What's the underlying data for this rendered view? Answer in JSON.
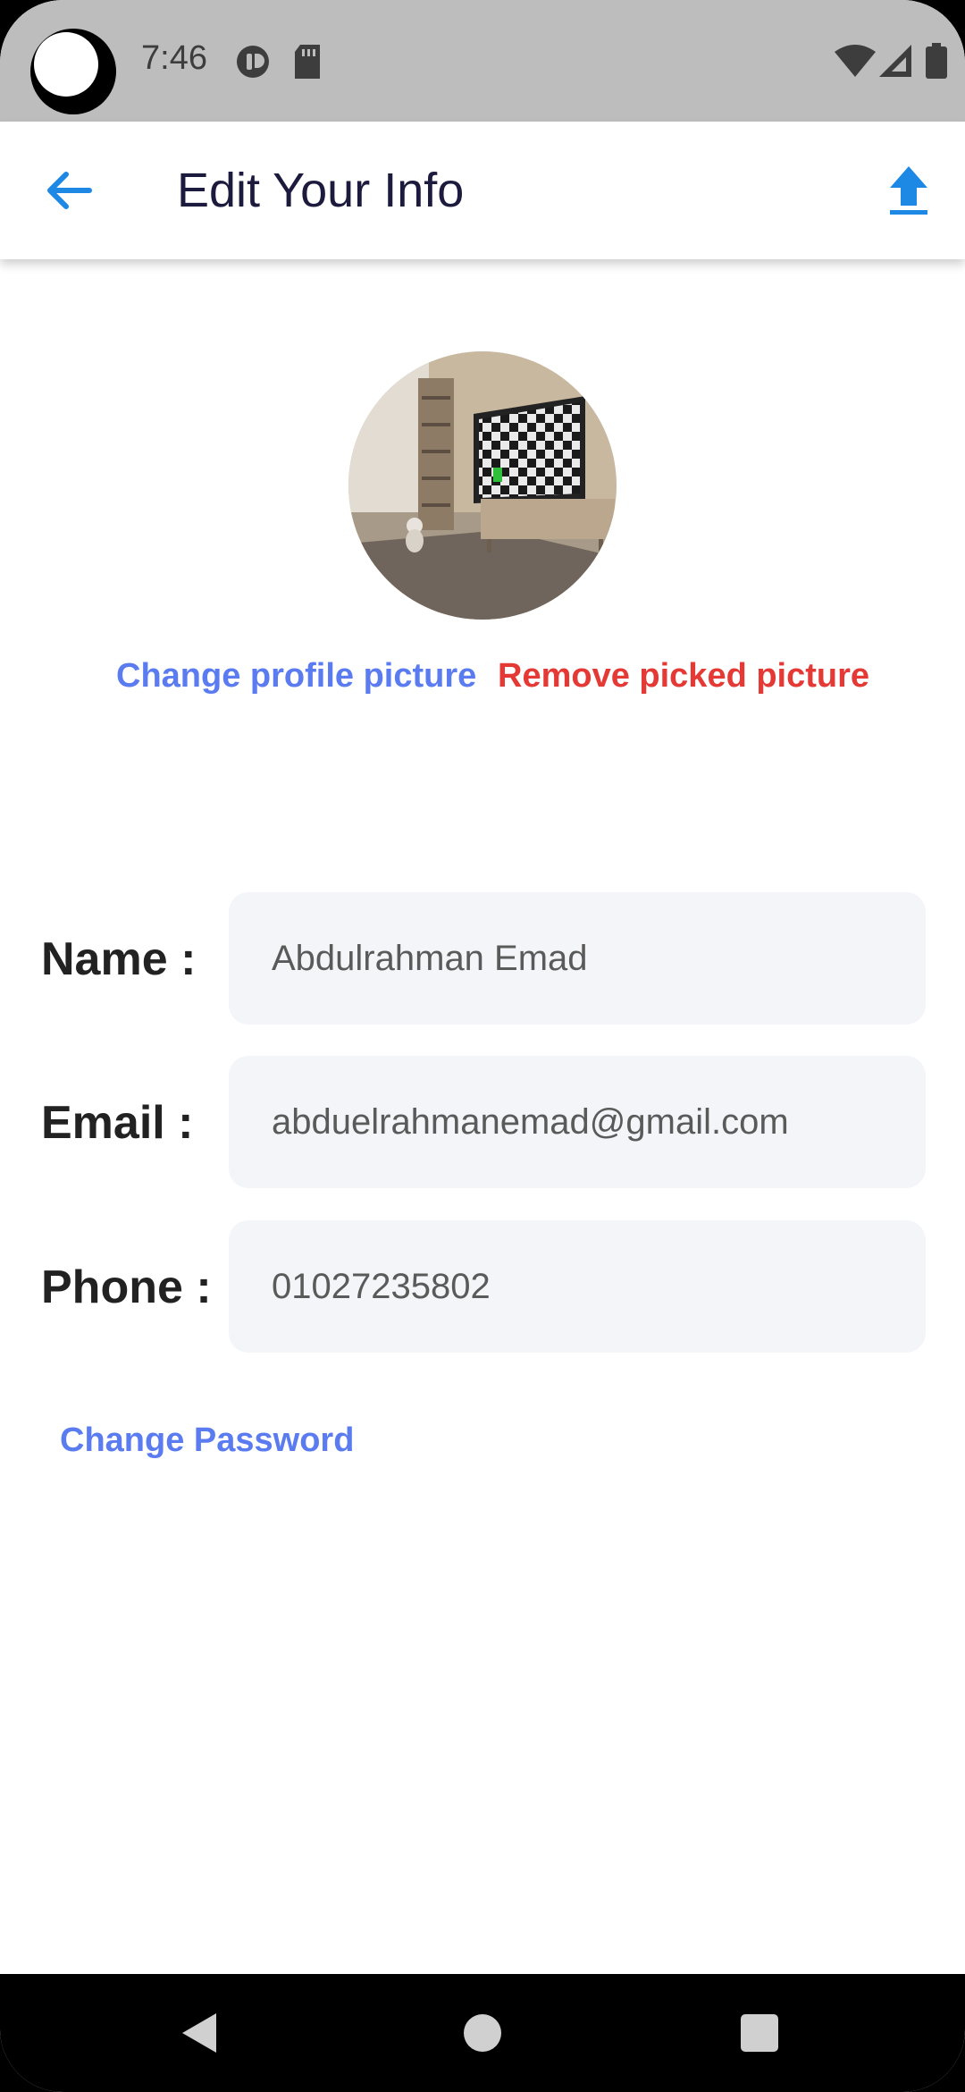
{
  "status_bar": {
    "time": "7:46",
    "icons": [
      "moon-dnd-icon",
      "nfc-icon",
      "sd-card-icon",
      "wifi-icon",
      "signal-icon",
      "battery-icon"
    ]
  },
  "app_bar": {
    "title": "Edit Your Info",
    "back_icon": "arrow-back-icon",
    "upload_icon": "upload-icon",
    "accent_color": "#1e88e5"
  },
  "profile": {
    "change_picture_label": "Change profile picture",
    "remove_picture_label": "Remove picked picture",
    "change_color": "#5b7cf0",
    "remove_color": "#e53935"
  },
  "form": {
    "name_label": "Name :",
    "name_value": "Abdulrahman Emad",
    "email_label": "Email :",
    "email_value": "abduelrahmanemad@gmail.com",
    "phone_label": "Phone :",
    "phone_value": "01027235802"
  },
  "change_password_label": "Change Password",
  "nav_bar": {
    "icons": [
      "back-triangle-icon",
      "home-circle-icon",
      "recents-square-icon"
    ]
  }
}
